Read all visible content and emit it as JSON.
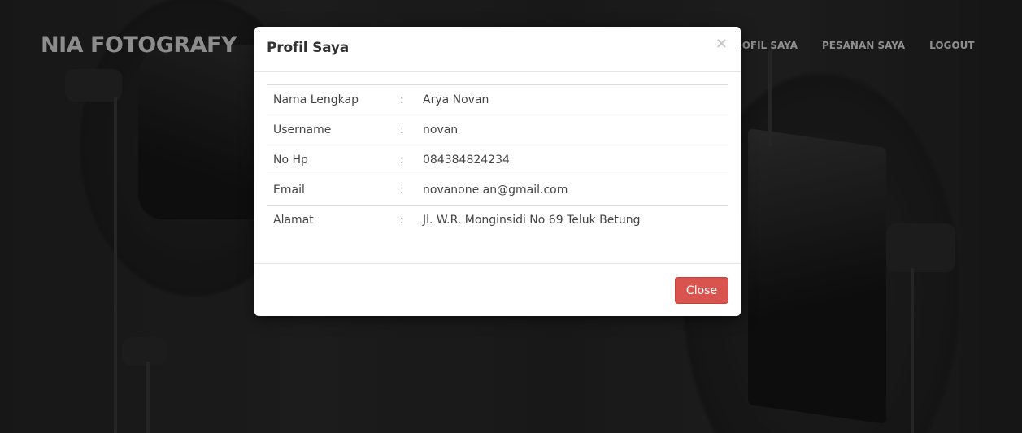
{
  "navbar": {
    "brand": "NIA FOTOGRAFY",
    "items": [
      {
        "label": "PROFIL SAYA"
      },
      {
        "label": "PESANAN SAYA"
      },
      {
        "label": "LOGOUT"
      }
    ]
  },
  "modal": {
    "title": "Profil Saya",
    "close_icon": "×",
    "rows": [
      {
        "label": "Nama Lengkap",
        "sep": ":",
        "value": "Arya Novan"
      },
      {
        "label": "Username",
        "sep": ":",
        "value": "novan"
      },
      {
        "label": "No Hp",
        "sep": ":",
        "value": "084384824234"
      },
      {
        "label": "Email",
        "sep": ":",
        "value": "novanone.an@gmail.com"
      },
      {
        "label": "Alamat",
        "sep": ":",
        "value": "Jl. W.R. Monginsidi No 69 Teluk Betung"
      }
    ],
    "close_button": "Close"
  },
  "colors": {
    "close_button_bg": "#d9534f",
    "brand_text": "#8d8d8d"
  }
}
